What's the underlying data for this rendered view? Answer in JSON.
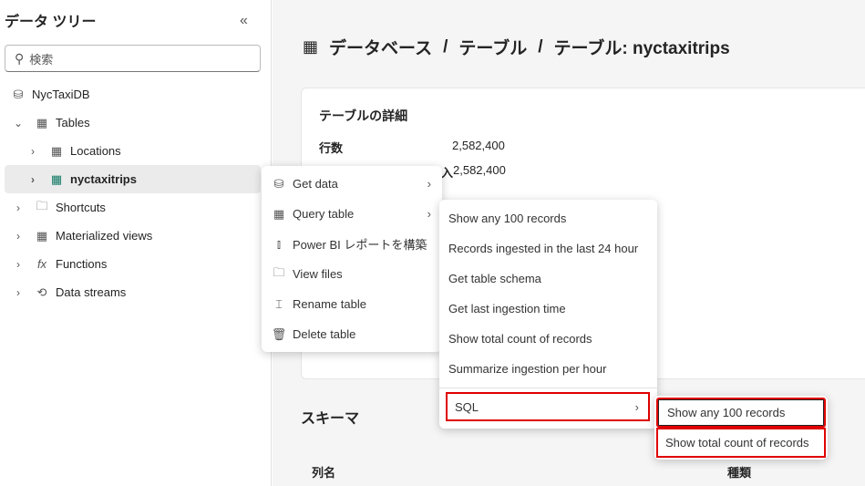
{
  "sidebar": {
    "title": "データ ツリー",
    "collapse_icon": "«",
    "search_placeholder": "検索",
    "items": [
      {
        "label": "NycTaxiDB",
        "icon": "database-icon"
      },
      {
        "label": "Tables",
        "icon": "tables-icon"
      },
      {
        "label": "Locations",
        "icon": "table-icon"
      },
      {
        "label": "nyctaxitrips",
        "icon": "table-icon"
      },
      {
        "label": "Shortcuts",
        "icon": "shortcut-folder-icon"
      },
      {
        "label": "Materialized views",
        "icon": "materialized-view-icon"
      },
      {
        "label": "Functions",
        "icon": "function-icon"
      },
      {
        "label": "Data streams",
        "icon": "data-stream-icon"
      }
    ]
  },
  "breadcrumb": {
    "part1": "データベース",
    "sep": "/",
    "part2": "テーブル",
    "part3": "テーブル: nyctaxitrips"
  },
  "details": {
    "title": "テーブルの詳細",
    "rows": [
      {
        "label": "行数",
        "value": "2,582,400"
      },
      {
        "label": "入",
        "value": "2,582,400"
      }
    ]
  },
  "schema": {
    "title": "スキーマ",
    "col_name": "列名",
    "col_type": "種類"
  },
  "context_menu": [
    "Get data",
    "Query table",
    "Power BI レポートを構築",
    "View files",
    "Rename table",
    "Delete table"
  ],
  "query_menu": [
    "Show any 100 records",
    "Records ingested in the last 24 hour",
    "Get table schema",
    "Get last ingestion time",
    "Show total count of records",
    "Summarize ingestion per hour",
    "SQL"
  ],
  "sql_menu": [
    "Show any 100 records",
    "Show total count of records"
  ],
  "colors": {
    "highlight": "#e00000",
    "table_green": "#117865"
  }
}
